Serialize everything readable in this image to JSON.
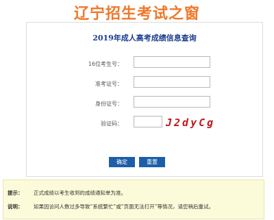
{
  "header": {
    "site_title": "辽宁招生考试之窗"
  },
  "form": {
    "title": "2019年成人高考成绩信息查询",
    "fields": [
      {
        "label": "16位考生号：",
        "value": ""
      },
      {
        "label": "准考证号：",
        "value": ""
      },
      {
        "label": "身份证号：",
        "value": ""
      },
      {
        "label": "验证码：",
        "value": ""
      }
    ],
    "captcha_text": "J2dyCg",
    "submit_label": "确定",
    "reset_label": "重置"
  },
  "notice": {
    "tip_label": "提示：",
    "tip_text": "正式成绩以考生收到的成绩通知单为准。",
    "note_label": "说明：",
    "note_text": "如果因访问人数过多导致“系统繁忙”或“页面无法打开”等情况，请您稍后重试。"
  },
  "colors": {
    "title_orange": "#f0782a",
    "heading_blue": "#1a3d8f",
    "button_blue": "#1d5ea8",
    "captcha_red": "#c0161c",
    "notice_bg": "#fbfbd9"
  }
}
